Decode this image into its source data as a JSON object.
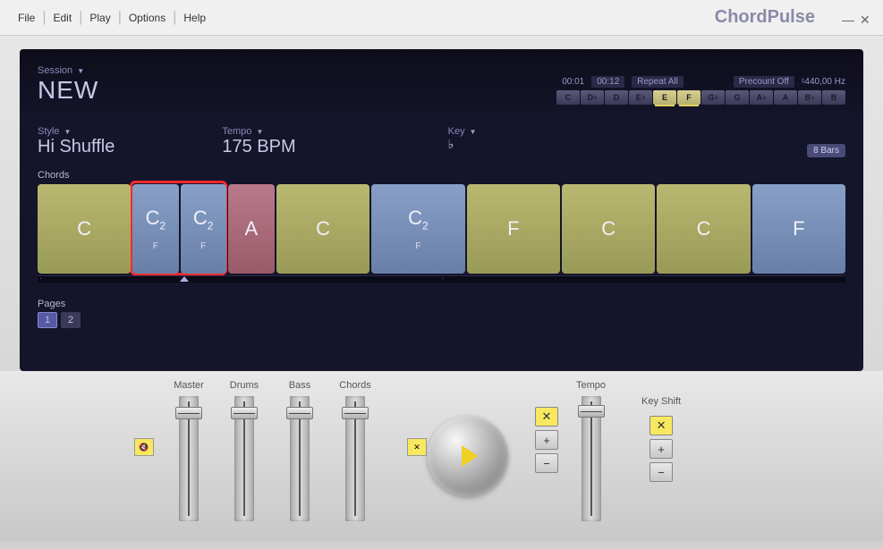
{
  "menu": {
    "file": "File",
    "edit": "Edit",
    "play": "Play",
    "options": "Options",
    "help": "Help"
  },
  "app_title": "ChordPulse",
  "session": {
    "label": "Session",
    "name": "NEW"
  },
  "transport": {
    "pos": "00:01",
    "total": "00:12",
    "repeat": "Repeat All",
    "precount": "Precount Off",
    "tuning": "♮440,00 Hz"
  },
  "keys": [
    "C",
    "D♭",
    "D",
    "E♭",
    "E",
    "F",
    "G♭",
    "G",
    "A♭",
    "A",
    "B♭",
    "B"
  ],
  "keys_active": [
    4,
    5
  ],
  "style": {
    "label": "Style",
    "value": "Hi Shuffle"
  },
  "tempo": {
    "label": "Tempo",
    "value": "175 BPM"
  },
  "key": {
    "label": "Key",
    "value": "♭"
  },
  "bars_badge": "8 Bars",
  "chords_label": "Chords",
  "chords": [
    {
      "label": "C",
      "sub": "",
      "color": "c-olive",
      "flex": 1
    },
    {
      "half": true,
      "a": {
        "label": "C",
        "num": "2",
        "sub": "F",
        "color": "c-blue"
      },
      "b": {
        "label": "C",
        "num": "2",
        "sub": "F",
        "color": "c-blue"
      },
      "flex": 1
    },
    {
      "label": "A",
      "sub": "",
      "color": "c-rose",
      "flex": 0.5
    },
    {
      "label": "C",
      "sub": "",
      "color": "c-olive",
      "flex": 1
    },
    {
      "label": "C",
      "num": "2",
      "sub": "F",
      "color": "c-blue",
      "flex": 1
    },
    {
      "label": "F",
      "sub": "",
      "color": "c-olive",
      "flex": 1
    },
    {
      "label": "C",
      "sub": "",
      "color": "c-olive",
      "flex": 1
    },
    {
      "label": "C",
      "sub": "",
      "color": "c-olive",
      "flex": 1
    },
    {
      "label": "F",
      "sub": "",
      "color": "c-blue",
      "flex": 1
    }
  ],
  "pages": {
    "label": "Pages",
    "items": [
      "1",
      "2"
    ],
    "active": 0
  },
  "mixer": {
    "faders": [
      {
        "label": "Master",
        "pos": 12
      },
      {
        "label": "Drums",
        "pos": 12
      },
      {
        "label": "Bass",
        "pos": 12
      },
      {
        "label": "Chords",
        "pos": 12
      }
    ],
    "tempo_label": "Tempo",
    "keyshift_label": "Key Shift",
    "plus": "+",
    "minus": "−",
    "center": "✕"
  }
}
